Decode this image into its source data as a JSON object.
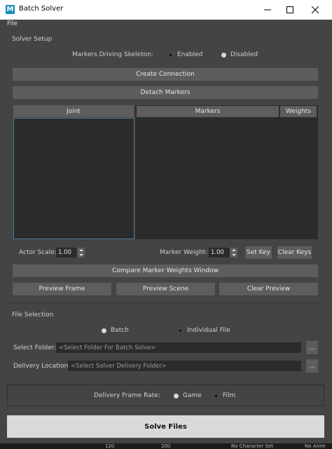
{
  "window": {
    "title": "Batch Solver",
    "app_icon": "M"
  },
  "menu": {
    "file": "File"
  },
  "solver_setup": {
    "section": "Solver Setup",
    "markers_driving_label": "Markers Driving Skeleton:",
    "enabled": "Enabled",
    "disabled": "Disabled",
    "selected": "Disabled",
    "create_connection": "Create Connection",
    "detach_markers": "Detach Markers",
    "columns": {
      "joint": "Joint",
      "markers": "Markers",
      "weights": "Weights"
    },
    "actor_scale_label": "Actor Scale:",
    "actor_scale_value": "1.00",
    "marker_weight_label": "Marker Weight:",
    "marker_weight_value": "1.00",
    "set_key": "Set Key",
    "clear_keys": "Clear Keys",
    "compare_window": "Compare Marker Weights Window",
    "preview_frame": "Preview Frame",
    "preview_scene": "Preview Scene",
    "clear_preview": "Clear Preview"
  },
  "file_selection": {
    "section": "File Selection",
    "batch": "Batch",
    "individual": "Individual File",
    "selected": "Batch",
    "select_folder_label": "Select Folder:",
    "select_folder_placeholder": "<Select Folder For Batch Solve>",
    "delivery_location_label": "Delivery Location:",
    "delivery_location_placeholder": "<Select Solver Delivery Folder>",
    "browse": "..."
  },
  "delivery": {
    "label": "Delivery Frame Rate:",
    "game": "Game",
    "film": "Film",
    "selected": "Game"
  },
  "solve_files": "Solve Files",
  "status": {
    "a": "120",
    "b": "200",
    "c": "No Character Set",
    "d": "No Anim"
  },
  "colors": {
    "bg": "#444444",
    "panel": "#2b2b2b",
    "button": "#5d5d5d",
    "solve_button": "#d9d9d9",
    "selection_border": "#4a7a99"
  }
}
